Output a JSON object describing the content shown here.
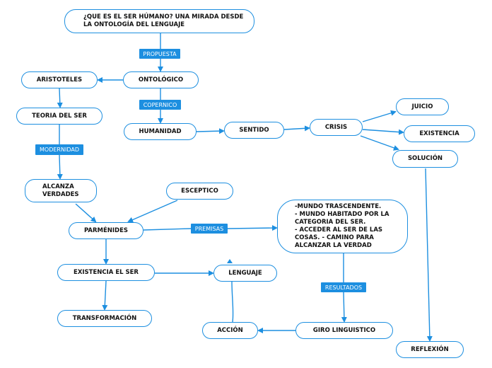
{
  "colors": {
    "accent": "#1d8fe0",
    "text": "#111111"
  },
  "nodes": {
    "title": "¿QUE ES EL SER HÚMANO? UNA MIRADA DESDE LA ONTOLOGÍA DEL LENGUAJE",
    "ontologico": "ONTOLÓGICO",
    "aristoteles": "ARISTOTELES",
    "teoria": "TEORIA DEL SER",
    "humanidad": "HUMANIDAD",
    "sentido": "SENTIDO",
    "crisis": "CRISIS",
    "juicio": "JUICIO",
    "existencia": "EXISTENCIA",
    "solucion": "SOLUCIÓN",
    "alcanza": "ALCANZA VERDADES",
    "esceptico": "ESCEPTICO",
    "parmenides": "PARMÉNIDES",
    "premisas_box": "-MUNDO TRASCENDENTE.\n- MUNDO HABITADO POR LA CATEGORIA DEL SER.\n- ACCEDER AL SER DE LAS COSAS.       - CAMINO PARA ALCANZAR LA VERDAD",
    "existencia_ser": "EXISTENCIA EL SER",
    "lenguaje": "LENGUAJE",
    "transformacion": "TRANSFORMACIÓN",
    "accion": "ACCIÓN",
    "giro": "GIRO LINGUISTICO",
    "reflexion": "REFLEXIÓN"
  },
  "labels": {
    "propuesta": "PROPUESTA",
    "copernico": "COPERNICO",
    "modernidad": "MODERNIDAD",
    "premisas": "PREMISAS",
    "resultados": "RESULTADOS"
  }
}
